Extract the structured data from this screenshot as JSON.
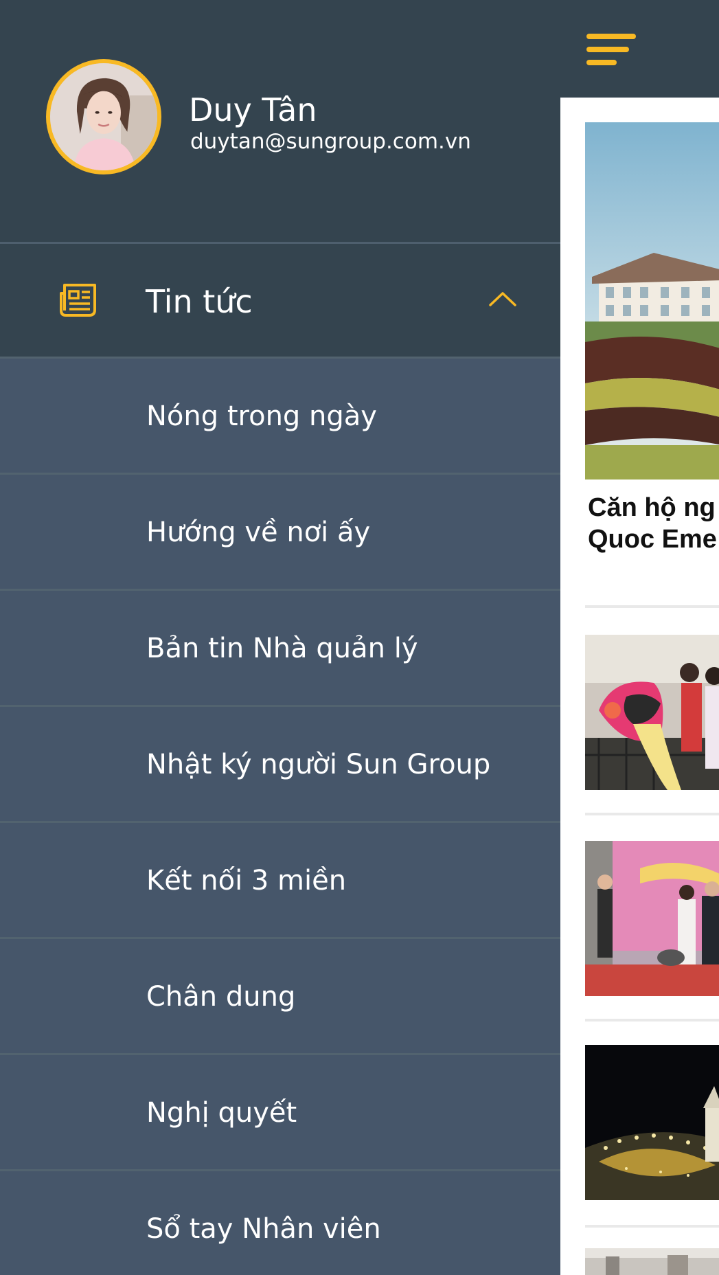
{
  "profile": {
    "name": "Duy Tân",
    "email": "duytan@sungroup.com.vn"
  },
  "menu": {
    "section_label": "Tin tức",
    "section_icon": "newspaper-icon",
    "expand_icon": "chevron-up-icon",
    "items": [
      {
        "label": "Nóng trong ngày"
      },
      {
        "label": "Hướng về nơi ấy"
      },
      {
        "label": "Bản tin Nhà quản lý"
      },
      {
        "label": "Nhật ký người Sun Group"
      },
      {
        "label": "Kết nối 3 miền"
      },
      {
        "label": "Chân dung"
      },
      {
        "label": "Nghị quyết"
      },
      {
        "label": "Sổ tay Nhân viên"
      }
    ]
  },
  "content": {
    "menu_icon": "hamburger-icon",
    "featured_title": "Căn hộ ng\nQuoc Eme"
  },
  "colors": {
    "accent": "#f8b924",
    "drawer_dark": "#34444f",
    "drawer": "#46566a",
    "divider": "#52636f"
  }
}
